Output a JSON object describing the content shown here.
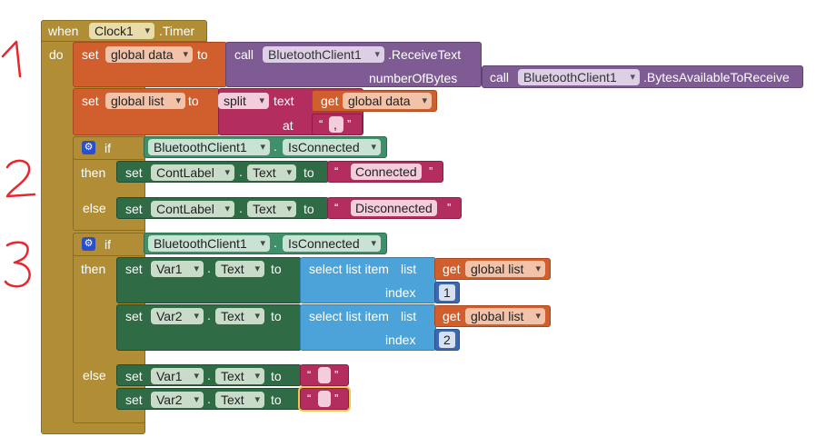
{
  "event": {
    "when": "when",
    "component": "Clock1",
    "event_name": ".Timer",
    "do": "do"
  },
  "row1": {
    "set": "set",
    "var": "global data",
    "to": "to",
    "call": "call",
    "component": "BluetoothClient1",
    "method": ".ReceiveText",
    "param": "numberOfBytes",
    "call2": "call",
    "component2": "BluetoothClient1",
    "method2": ".BytesAvailableToReceive"
  },
  "row2": {
    "set": "set",
    "var": "global list",
    "to": "to",
    "split": "split",
    "text_label": "text",
    "get": "get",
    "get_var": "global data",
    "at": "at",
    "at_value": ","
  },
  "if1": {
    "if": "if",
    "component": "BluetoothClient1",
    "prop": "IsConnected",
    "then": "then",
    "else": "else",
    "then_set": "set",
    "then_comp": "ContLabel",
    "then_prop": "Text",
    "then_to": "to",
    "then_value": "Connected",
    "else_set": "set",
    "else_comp": "ContLabel",
    "else_prop": "Text",
    "else_to": "to",
    "else_value": "Disconnected"
  },
  "if2": {
    "if": "if",
    "component": "BluetoothClient1",
    "prop": "IsConnected",
    "then": "then",
    "else": "else",
    "a_set": "set",
    "a_comp": "Var1",
    "a_prop": "Text",
    "a_to": "to",
    "a_select": "select list item",
    "a_list": "list",
    "a_get": "get",
    "a_get_var": "global list",
    "a_index": "index",
    "a_index_val": "1",
    "b_set": "set",
    "b_comp": "Var2",
    "b_prop": "Text",
    "b_to": "to",
    "b_select": "select list item",
    "b_list": "list",
    "b_get": "get",
    "b_get_var": "global list",
    "b_index": "index",
    "b_index_val": "2",
    "c_set": "set",
    "c_comp": "Var1",
    "c_prop": "Text",
    "c_to": "to",
    "d_set": "set",
    "d_comp": "Var2",
    "d_prop": "Text",
    "d_to": "to"
  },
  "colors": {
    "event": "#B18E35",
    "variable": "#D05F2D",
    "bluetooth": "#7E5B93",
    "logic": "#3F8F6A",
    "component": "#2F6B45",
    "text": "#B32D5E",
    "list": "#4BA3D9",
    "annotation": "#e8262d"
  },
  "icons": {
    "mutator": "gear-icon",
    "dropdown": "chevron-down-icon"
  }
}
